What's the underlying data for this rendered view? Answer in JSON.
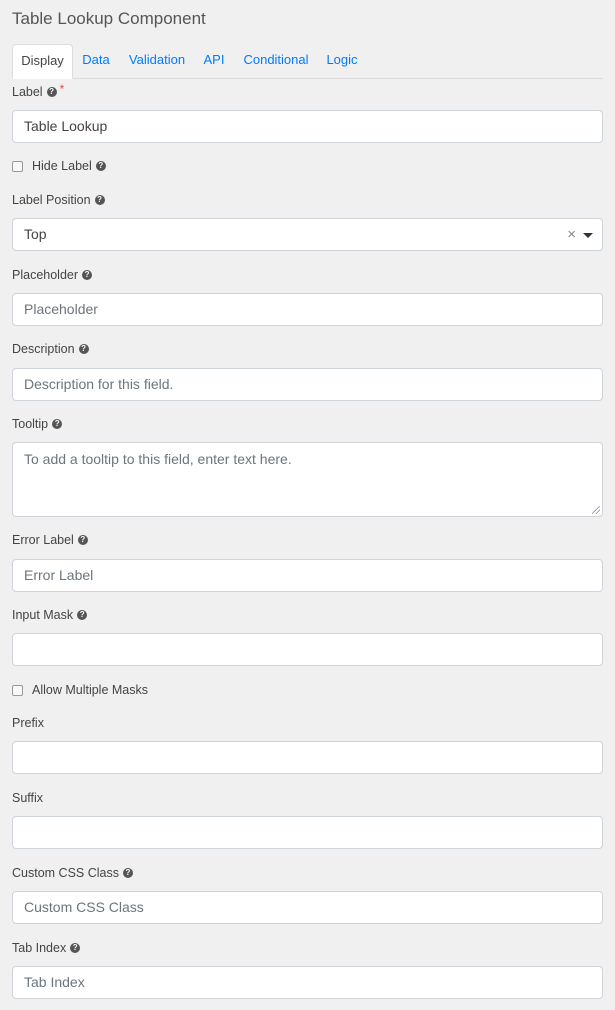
{
  "title": "Table Lookup Component",
  "tabs": [
    {
      "label": "Display",
      "active": true
    },
    {
      "label": "Data",
      "active": false
    },
    {
      "label": "Validation",
      "active": false
    },
    {
      "label": "API",
      "active": false
    },
    {
      "label": "Conditional",
      "active": false
    },
    {
      "label": "Logic",
      "active": false
    }
  ],
  "colors": {
    "accent": "#007bff",
    "required": "#e74c3c",
    "background": "#f0f0f0"
  },
  "fields": {
    "label": {
      "label": "Label",
      "value": "Table Lookup",
      "required_mark": "*"
    },
    "hide_label": {
      "label": "Hide Label",
      "checked": false
    },
    "label_position": {
      "label": "Label Position",
      "value": "Top",
      "clear_glyph": "×"
    },
    "placeholder": {
      "label": "Placeholder",
      "placeholder": "Placeholder"
    },
    "description": {
      "label": "Description",
      "placeholder": "Description for this field."
    },
    "tooltip": {
      "label": "Tooltip",
      "placeholder": "To add a tooltip to this field, enter text here."
    },
    "error_label": {
      "label": "Error Label",
      "placeholder": "Error Label"
    },
    "input_mask": {
      "label": "Input Mask",
      "value": ""
    },
    "allow_multiple_masks": {
      "label": "Allow Multiple Masks",
      "checked": false
    },
    "prefix": {
      "label": "Prefix",
      "value": ""
    },
    "suffix": {
      "label": "Suffix",
      "value": ""
    },
    "custom_css_class": {
      "label": "Custom CSS Class",
      "placeholder": "Custom CSS Class"
    },
    "tab_index": {
      "label": "Tab Index",
      "placeholder": "Tab Index"
    }
  },
  "help_glyph": "?"
}
